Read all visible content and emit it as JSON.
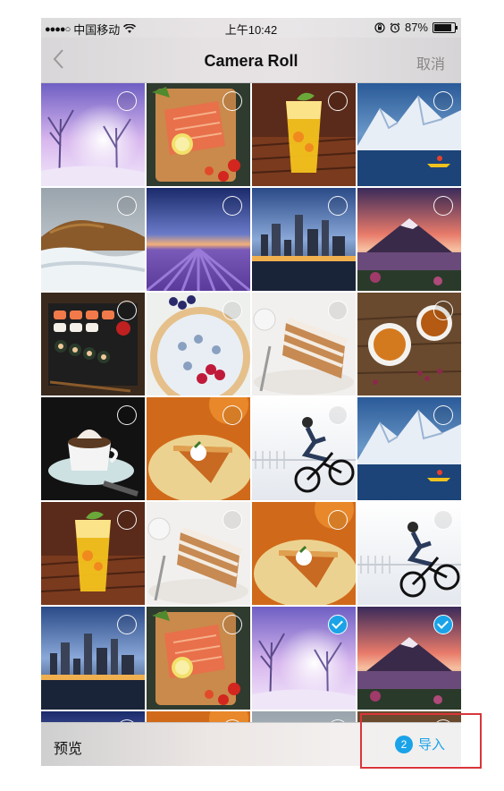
{
  "status_bar": {
    "signal": "●●●●○",
    "carrier": "中国移动",
    "time": "上午10:42",
    "battery_percent": "87%",
    "battery_level": 0.87
  },
  "nav": {
    "title": "Camera Roll",
    "cancel": "取消"
  },
  "grid": {
    "photos": [
      {
        "theme": "winter-sunrise",
        "selected": false
      },
      {
        "theme": "salmon-board",
        "selected": false
      },
      {
        "theme": "orange-drink",
        "selected": false
      },
      {
        "theme": "glacier-kayak",
        "selected": false
      },
      {
        "theme": "ice-mountain",
        "selected": false
      },
      {
        "theme": "lavender-field",
        "selected": false
      },
      {
        "theme": "city-skyline",
        "selected": false
      },
      {
        "theme": "volcano-sunset",
        "selected": false
      },
      {
        "theme": "sushi-platter",
        "selected": false
      },
      {
        "theme": "berry-tart",
        "selected": false
      },
      {
        "theme": "layer-cake",
        "selected": false
      },
      {
        "theme": "tea-cups",
        "selected": false
      },
      {
        "theme": "coffee-cup",
        "selected": false
      },
      {
        "theme": "pumpkin-pie",
        "selected": false
      },
      {
        "theme": "bmx-rider",
        "selected": false
      },
      {
        "theme": "glacier-kayak",
        "selected": false
      },
      {
        "theme": "orange-drink",
        "selected": false
      },
      {
        "theme": "layer-cake",
        "selected": false
      },
      {
        "theme": "pumpkin-pie",
        "selected": false
      },
      {
        "theme": "bmx-rider",
        "selected": false
      },
      {
        "theme": "city-skyline",
        "selected": false
      },
      {
        "theme": "salmon-board",
        "selected": false
      },
      {
        "theme": "winter-sunrise",
        "selected": true
      },
      {
        "theme": "volcano-sunset",
        "selected": true
      },
      {
        "theme": "lavender-field",
        "selected": false
      },
      {
        "theme": "pumpkin-pie",
        "selected": false
      },
      {
        "theme": "ice-mountain",
        "selected": false
      },
      {
        "theme": "tea-cups",
        "selected": false
      }
    ]
  },
  "bottom_bar": {
    "preview": "预览",
    "import_count": "2",
    "import_label": "导入"
  },
  "colors": {
    "accent": "#1aa3e8",
    "highlight": "#d9353a"
  }
}
